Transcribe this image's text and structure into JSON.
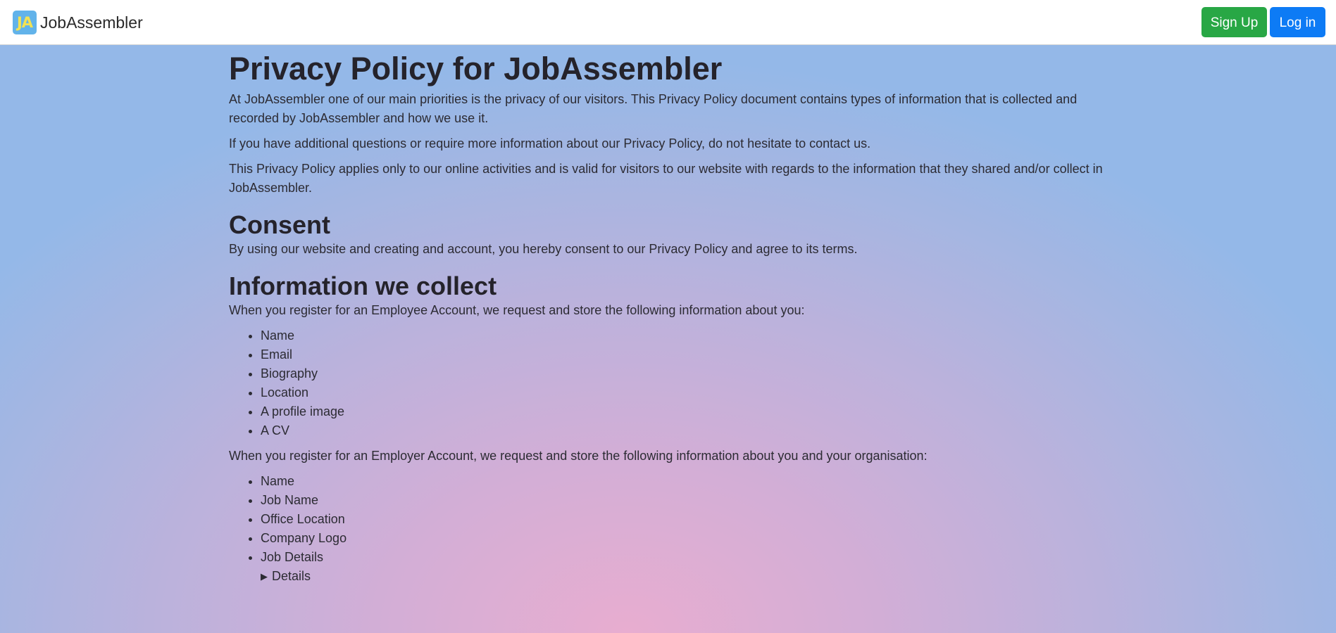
{
  "navbar": {
    "logo_text": "JA",
    "brand": "JobAssembler",
    "signup_label": "Sign Up",
    "login_label": "Log in"
  },
  "page": {
    "title": "Privacy Policy for JobAssembler",
    "intro_1": "At JobAssembler one of our main priorities is the privacy of our visitors. This Privacy Policy document contains types of information that is collected and recorded by JobAssembler and how we use it.",
    "intro_2": "If you have additional questions or require more information about our Privacy Policy, do not hesitate to contact us.",
    "intro_3": "This Privacy Policy applies only to our online activities and is valid for visitors to our website with regards to the information that they shared and/or collect in JobAssembler.",
    "consent_heading": "Consent",
    "consent_text": "By using our website and creating and account, you hereby consent to our Privacy Policy and agree to its terms.",
    "collect_heading": "Information we collect",
    "employee_text": "When you register for an Employee Account, we request and store the following information about you:",
    "employee_items": [
      "Name",
      "Email",
      "Biography",
      "Location",
      "A profile image",
      "A CV"
    ],
    "employer_text": "When you register for an Employer Account, we request and store the following information about you and your organisation:",
    "employer_items": [
      "Name",
      "Job Name",
      "Office Location",
      "Company Logo",
      "Job Details"
    ],
    "details_label": "Details"
  }
}
